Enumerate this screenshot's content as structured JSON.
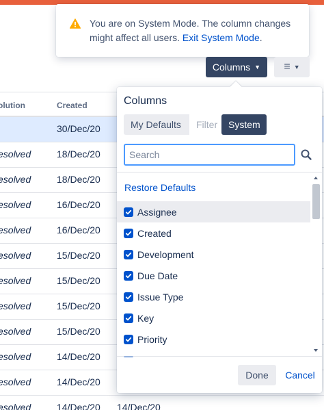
{
  "flag": {
    "message": "You are on System Mode. The column changes might affect all users.",
    "link": "Exit System Mode",
    "after_link": "."
  },
  "toolbar": {
    "columns_label": "Columns",
    "view_icon": "list-icon"
  },
  "table": {
    "headers": {
      "resolution": "olution",
      "created": "Created"
    },
    "rows": [
      {
        "resolution": "",
        "created": "30/Dec/20",
        "extra": "",
        "selected": true
      },
      {
        "resolution": "esolved",
        "created": "18/Dec/20",
        "extra": ""
      },
      {
        "resolution": "esolved",
        "created": "18/Dec/20",
        "extra": ""
      },
      {
        "resolution": "esolved",
        "created": "16/Dec/20",
        "extra": ""
      },
      {
        "resolution": "esolved",
        "created": "16/Dec/20",
        "extra": ""
      },
      {
        "resolution": "esolved",
        "created": "15/Dec/20",
        "extra": ""
      },
      {
        "resolution": "esolved",
        "created": "15/Dec/20",
        "extra": ""
      },
      {
        "resolution": "esolved",
        "created": "15/Dec/20",
        "extra": ""
      },
      {
        "resolution": "esolved",
        "created": "15/Dec/20",
        "extra": ""
      },
      {
        "resolution": "esolved",
        "created": "14/Dec/20",
        "extra": ""
      },
      {
        "resolution": "esolved",
        "created": "14/Dec/20",
        "extra": ""
      },
      {
        "resolution": "esolved",
        "created": "14/Dec/20",
        "extra": "14/Dec/20"
      }
    ]
  },
  "dialog": {
    "title": "Columns",
    "tabs": [
      "My Defaults",
      "Filter",
      "System"
    ],
    "active_tab": "System",
    "search_placeholder": "Search",
    "restore_label": "Restore Defaults",
    "items": [
      "Assignee",
      "Created",
      "Development",
      "Due Date",
      "Issue Type",
      "Key",
      "Priority"
    ],
    "hovered_item": "Assignee",
    "done_label": "Done",
    "cancel_label": "Cancel"
  },
  "colors": {
    "accent": "#e8603c",
    "primary_dark": "#344563",
    "link": "#0052cc",
    "warning": "#ffab00"
  }
}
